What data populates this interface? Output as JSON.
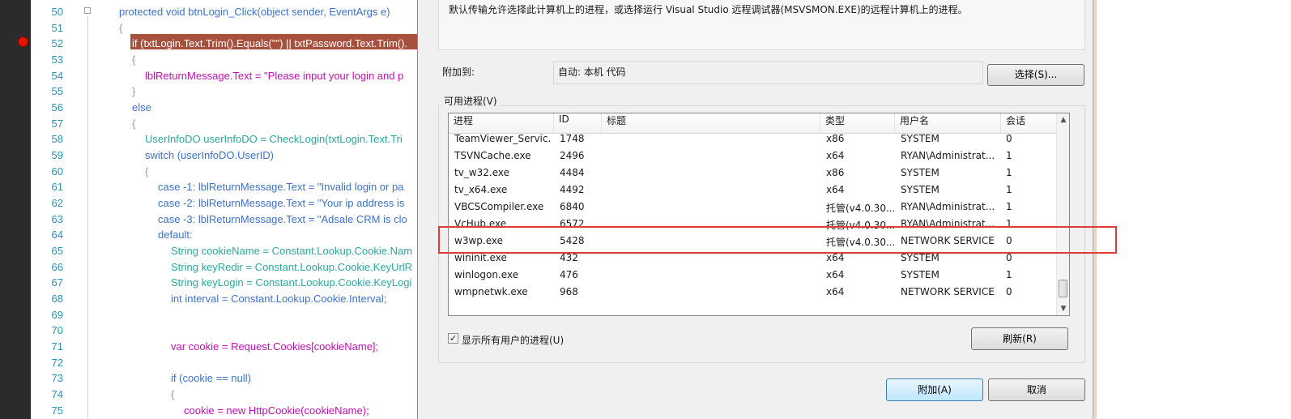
{
  "editor": {
    "line_numbers": [
      "50",
      "51",
      "52",
      "53",
      "54",
      "55",
      "56",
      "57",
      "58",
      "59",
      "60",
      "61",
      "62",
      "63",
      "64",
      "65",
      "66",
      "67",
      "68",
      "69",
      "70",
      "71",
      "72",
      "73",
      "74",
      "75"
    ],
    "lines": [
      "protected void btnLogin_Click(object sender, EventArgs e)",
      "{",
      "if (txtLogin.Text.Trim().Equals(\"\") || txtPassword.Text.Trim().",
      "{",
      "lblReturnMessage.Text = \"Please input your login and p",
      "}",
      "else",
      "{",
      "UserInfoDO userInfoDO = CheckLogin(txtLogin.Text.Tri",
      "switch (userInfoDO.UserID)",
      "{",
      "case -1: lblReturnMessage.Text = \"Invalid login or pa",
      "case -2: lblReturnMessage.Text = \"Your ip address is",
      "case -3: lblReturnMessage.Text = \"Adsale CRM is clo",
      "default:",
      "String cookieName = Constant.Lookup.Cookie.Nam",
      "String keyRedir = Constant.Lookup.Cookie.KeyUrlR",
      "String keyLogin = Constant.Lookup.Cookie.KeyLogi",
      "int interval = Constant.Lookup.Cookie.Interval;",
      "",
      "",
      "var cookie = Request.Cookies[cookieName];",
      "",
      "if (cookie == null)",
      "{",
      "cookie = new HttpCookie(cookieName);"
    ]
  },
  "dialog": {
    "description": "默认传输允许选择此计算机上的进程，或选择运行 Visual Studio 远程调试器(MSVSMON.EXE)的远程计算机上的进程。",
    "attach_to_label": "附加到:",
    "attach_to_value": "自动: 本机 代码",
    "select_button": "选择(S)...",
    "available_label": "可用进程(V)",
    "columns": [
      "进程",
      "ID",
      "标题",
      "类型",
      "用户名",
      "会话"
    ],
    "processes": [
      {
        "name": "TeamViewer_Servic...",
        "id": "1748",
        "title": "",
        "type": "x86",
        "user": "SYSTEM",
        "session": "0"
      },
      {
        "name": "TSVNCache.exe",
        "id": "2496",
        "title": "",
        "type": "x64",
        "user": "RYAN\\Administrat...",
        "session": "1"
      },
      {
        "name": "tv_w32.exe",
        "id": "4484",
        "title": "",
        "type": "x86",
        "user": "SYSTEM",
        "session": "1"
      },
      {
        "name": "tv_x64.exe",
        "id": "4492",
        "title": "",
        "type": "x64",
        "user": "SYSTEM",
        "session": "1"
      },
      {
        "name": "VBCSCompiler.exe",
        "id": "6840",
        "title": "",
        "type": "托管(v4.0.30...",
        "user": "RYAN\\Administrat...",
        "session": "1"
      },
      {
        "name": "VcHub.exe",
        "id": "6572",
        "title": "",
        "type": "托管(v4.0.30...",
        "user": "RYAN\\Administrat...",
        "session": "1"
      },
      {
        "name": "w3wp.exe",
        "id": "5428",
        "title": "",
        "type": "托管(v4.0.30...",
        "user": "NETWORK SERVICE",
        "session": "0"
      },
      {
        "name": "wininit.exe",
        "id": "432",
        "title": "",
        "type": "x64",
        "user": "SYSTEM",
        "session": "0"
      },
      {
        "name": "winlogon.exe",
        "id": "476",
        "title": "",
        "type": "x64",
        "user": "SYSTEM",
        "session": "1"
      },
      {
        "name": "wmpnetwk.exe",
        "id": "968",
        "title": "",
        "type": "x64",
        "user": "NETWORK SERVICE",
        "session": "0"
      }
    ],
    "show_all_users_label": "显示所有用户的进程(U)",
    "show_all_users_checked": true,
    "refresh_button": "刷新(R)",
    "attach_button": "附加(A)",
    "cancel_button": "取消",
    "highlight_color": "#e03c3c",
    "breakpoint_color": "#e51400"
  }
}
